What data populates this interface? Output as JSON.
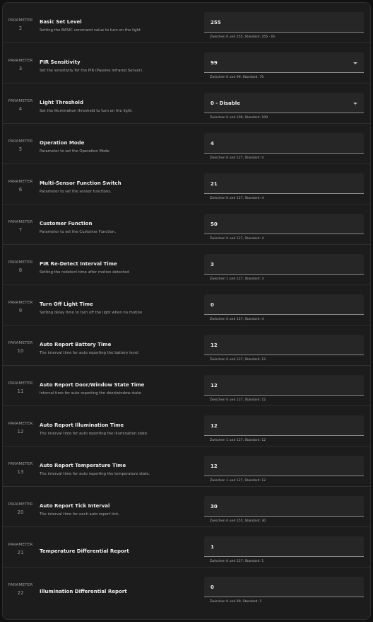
{
  "param_label": "PARAMETER",
  "rows": [
    {
      "num": "2",
      "title": "Basic Set Level",
      "desc": "Setting the BASIC command value to turn on the light.",
      "value": "255",
      "dropdown": false,
      "hint": "Zwischen 0 und 255, Standard: 255 - 0n"
    },
    {
      "num": "3",
      "title": "PIR Sensitivity",
      "desc": "Set the sensitivity for the PIR (Passive Infrared Sensor).",
      "value": "99",
      "dropdown": true,
      "hint": "Zwischen 0 und 99, Standard: 70"
    },
    {
      "num": "4",
      "title": "Light Threshold",
      "desc": "Set the illumination threshold to turn on the light.",
      "value": "0 - Disable",
      "dropdown": true,
      "hint": "Zwischen 0 und 100, Standard: 100"
    },
    {
      "num": "5",
      "title": "Operation Mode",
      "desc": "Parameter to set the Operation Mode",
      "value": "4",
      "dropdown": false,
      "hint": "Zwischen 0 und 127, Standard: 0"
    },
    {
      "num": "6",
      "title": "Multi-Sensor Function Switch",
      "desc": "Parameter to set the sensor functions.",
      "value": "21",
      "dropdown": false,
      "hint": "Zwischen 0 und 127, Standard: 4"
    },
    {
      "num": "7",
      "title": "Customer Function",
      "desc": "Parameter to set the Customer Function.",
      "value": "50",
      "dropdown": false,
      "hint": "Zwischen 0 und 127, Standard: 4"
    },
    {
      "num": "8",
      "title": "PIR Re-Detect Interval Time",
      "desc": "Setting the redetect time after motion detected",
      "value": "3",
      "dropdown": false,
      "hint": "Zwischen 1 und 127, Standard: 3"
    },
    {
      "num": "9",
      "title": "Turn Off Light Time",
      "desc": "Setting delay time to turn off the light when no motion",
      "value": "0",
      "dropdown": false,
      "hint": "Zwischen 0 und 127, Standard: 4"
    },
    {
      "num": "10",
      "title": "Auto Report Battery Time",
      "desc": "The interval time for auto reporting the battery level.",
      "value": "12",
      "dropdown": false,
      "hint": "Zwischen 0 und 127, Standard: 12"
    },
    {
      "num": "11",
      "title": "Auto Report Door/Window State Time",
      "desc": "Interval time for auto reporting the door/window state.",
      "value": "12",
      "dropdown": false,
      "hint": "Zwischen 0 und 127, Standard: 12"
    },
    {
      "num": "12",
      "title": "Auto Report Illumination Time",
      "desc": "The interval time for auto reporting the illumination state.",
      "value": "12",
      "dropdown": false,
      "hint": "Zwischen 1 und 127, Standard: 12"
    },
    {
      "num": "13",
      "title": "Auto Report Temperature Time",
      "desc": "The interval time for auto reporting the temperature state.",
      "value": "12",
      "dropdown": false,
      "hint": "Zwischen 1 und 127, Standard: 12"
    },
    {
      "num": "20",
      "title": "Auto Report Tick Interval",
      "desc": "The interval time for each auto report tick.",
      "value": "30",
      "dropdown": false,
      "hint": "Zwischen 0 und 255, Standard: 30"
    },
    {
      "num": "21",
      "title": "Temperature Differential Report",
      "desc": "",
      "value": "1",
      "dropdown": false,
      "hint": "Zwischen 0 und 127, Standard: 1"
    },
    {
      "num": "22",
      "title": "Illumination Differential Report",
      "desc": "",
      "value": "0",
      "dropdown": false,
      "hint": "Zwischen 0 und 99, Standard: 1"
    }
  ]
}
